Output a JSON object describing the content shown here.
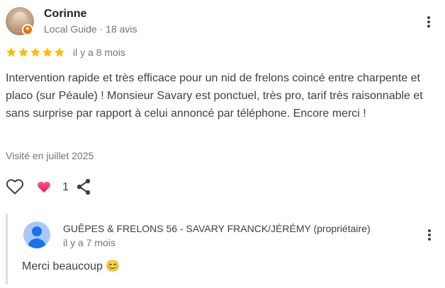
{
  "review": {
    "author": "Corinne",
    "author_meta": "Local Guide · 18 avis",
    "rating": 5,
    "star_color": "#fbbc04",
    "date": "il y a 8 mois",
    "text": "Intervention rapide et très efficace pour un nid de frelons coincé entre charpente et placo (sur Péaule) ! Monsieur Savary est ponctuel, très pro, tarif très raisonnable et sans surprise par rapport à celui annoncé par téléphone. Encore merci !",
    "visit": "Visité en juillet 2025",
    "like_count": "1",
    "icons": {
      "more": "more-vertical-icon",
      "like": "heart-outline-icon",
      "reaction": "heart-filled-icon",
      "share": "share-icon",
      "badge": "local-guide-badge-icon"
    }
  },
  "owner_reply": {
    "name": "GUÊPES & FRELONS 56 - SAVARY FRANCK/JÉRÉMY (propriétaire)",
    "date": "il y a 7 mois",
    "text": "Merci beaucoup 😊"
  }
}
